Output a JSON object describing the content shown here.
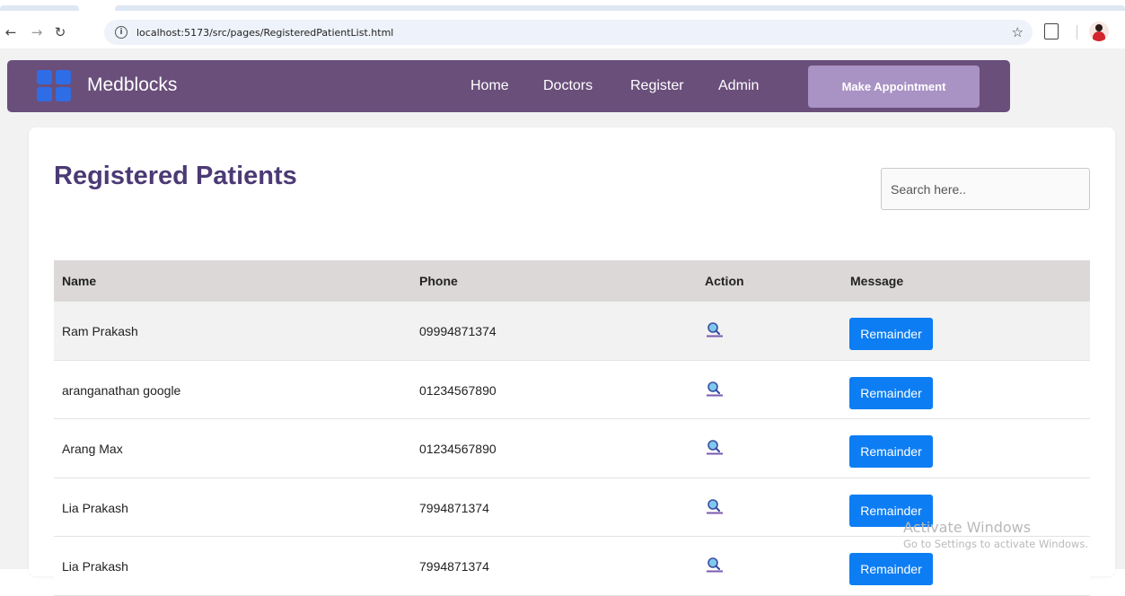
{
  "browser": {
    "url": "localhost:5173/src/pages/RegisteredPatientList.html"
  },
  "navbar": {
    "brand": "Medblocks",
    "links": [
      "Home",
      "Doctors",
      "Register",
      "Admin"
    ],
    "cta_label": "Make Appointment",
    "colors": {
      "background": "#6a4f7b",
      "cta": "#a992c4"
    }
  },
  "main": {
    "title": "Registered Patients",
    "search_placeholder": "Search here.."
  },
  "table": {
    "columns": [
      "Name",
      "Phone",
      "Action",
      "Message"
    ],
    "rows": [
      {
        "name": "Ram Prakash",
        "phone": "09994871374",
        "button": "Remainder"
      },
      {
        "name": "aranganathan google",
        "phone": "01234567890",
        "button": "Remainder"
      },
      {
        "name": "Arang Max",
        "phone": "01234567890",
        "button": "Remainder"
      },
      {
        "name": "Lia Prakash",
        "phone": "7994871374",
        "button": "Remainder"
      },
      {
        "name": "Lia Prakash",
        "phone": "7994871374",
        "button": "Remainder"
      }
    ]
  },
  "watermark": {
    "title": "Activate Windows",
    "subtitle": "Go to Settings to activate Windows."
  }
}
